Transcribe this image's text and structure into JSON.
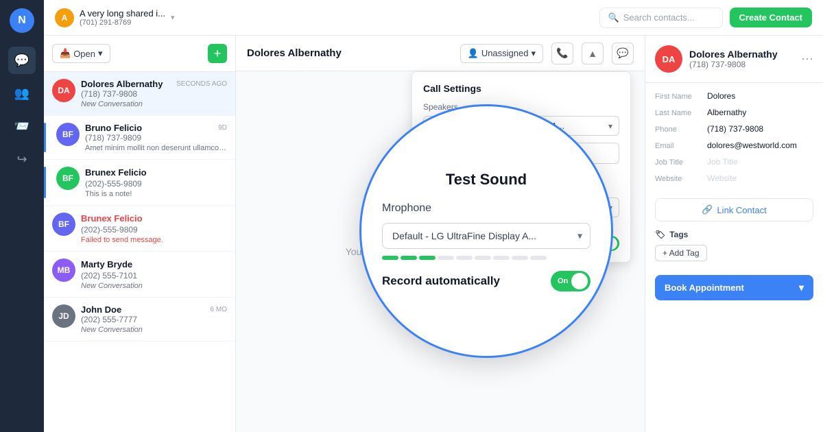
{
  "app": {
    "logo": "N",
    "workspace": {
      "avatar": "A",
      "name": "A very long shared i...",
      "phone": "(701) 291-8769",
      "chevron": "▾"
    }
  },
  "header": {
    "search_placeholder": "Search contacts...",
    "create_contact_label": "Create Contact"
  },
  "conversation_list": {
    "open_btn_label": "Open",
    "add_btn_label": "+",
    "items": [
      {
        "initials": "DA",
        "avatar_class": "av-da",
        "name": "Dolores Albernathy",
        "phone": "(718) 737-9808",
        "sub": "New Conversation",
        "sub_class": "italic",
        "time": "SECONDS AGO",
        "active": true
      },
      {
        "initials": "BF",
        "avatar_class": "av-bf",
        "name": "Bruno Felicio",
        "phone": "(718) 737-9809",
        "sub": "Amet minim mollit non deserunt ullamco e...",
        "sub_class": "note",
        "time": "9D",
        "has_bar": true
      },
      {
        "initials": "BF",
        "avatar_class": "av-bfg",
        "name": "Brunex Felicio",
        "phone": "(202)-555-9809",
        "sub": "This is a note!",
        "sub_class": "note",
        "time": "",
        "has_bar": true
      },
      {
        "initials": "BF",
        "avatar_class": "av-bf",
        "name": "Brunex Felicio",
        "phone": "(202)-555-9809",
        "name_class": "red",
        "sub": "Failed to send message.",
        "sub_class": "error",
        "time": ""
      },
      {
        "initials": "MB",
        "avatar_class": "av-mb",
        "name": "Marty Bryde",
        "phone": "(202) 555-7101",
        "sub": "New Conversation",
        "sub_class": "italic",
        "time": ""
      },
      {
        "initials": "JD",
        "avatar_class": "av-jd",
        "name": "John Doe",
        "phone": "(202) 555-7777",
        "sub": "New Conversation",
        "sub_class": "italic",
        "time": "6 MO"
      }
    ]
  },
  "chat": {
    "contact_name": "Dolores Albernathy",
    "empty_message": "You have not interacted with this contact yet.",
    "assign_label": "Unassigned",
    "assign_icon": "▾"
  },
  "call_settings": {
    "title": "Call Settings",
    "speakers_label": "Speakers",
    "speakers_value": "Default - LG UltraFine Display A...",
    "test_sound_label": "Test Sound",
    "microphone_label": "Microphone",
    "microphone_value": "Default - LG UltraFine Display A...",
    "record_label": "Record automatically",
    "record_state": "On",
    "volume_segments": [
      3,
      3,
      10
    ],
    "toggle_label": "On"
  },
  "magnify": {
    "title": "Test Sound",
    "subtitle": "rophone",
    "select_value": "Default - LG UltraFine Display A...",
    "record_label": "Record automatically",
    "toggle_label": "On",
    "volume_segments": [
      3,
      3,
      10
    ]
  },
  "contact_panel": {
    "avatar": "DA",
    "name": "Dolores Albernathy",
    "phone": "(718) 737-9808",
    "fields": [
      {
        "label": "First Name",
        "value": "Dolores",
        "is_placeholder": false
      },
      {
        "label": "Last Name",
        "value": "Albernathy",
        "is_placeholder": false
      },
      {
        "label": "Phone",
        "value": "(718) 737-9808",
        "is_placeholder": false
      },
      {
        "label": "Email",
        "value": "dolores@westworld.com",
        "is_placeholder": false
      },
      {
        "label": "Job Title",
        "value": "Job Title",
        "is_placeholder": true
      },
      {
        "label": "Website",
        "value": "Website",
        "is_placeholder": true
      }
    ],
    "link_contact_label": "Link Contact",
    "tags_label": "Tags",
    "add_tag_label": "+ Add Tag",
    "book_appointment_label": "Book Appointment"
  },
  "nav": {
    "items": [
      {
        "icon": "💬",
        "name": "messages",
        "active": true
      },
      {
        "icon": "👥",
        "name": "contacts",
        "active": false
      },
      {
        "icon": "📨",
        "name": "campaigns",
        "active": false
      },
      {
        "icon": "↩",
        "name": "workflows",
        "active": false
      }
    ]
  }
}
